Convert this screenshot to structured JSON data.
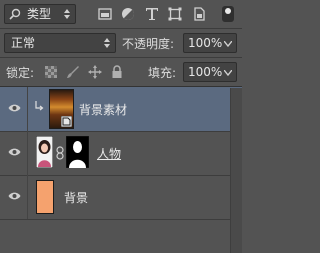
{
  "filter": {
    "kind_label": "类型"
  },
  "blend": {
    "mode": "正常",
    "opacity_label": "不透明度:",
    "opacity_value": "100%"
  },
  "lock": {
    "label": "锁定:",
    "fill_label": "填充:",
    "fill_value": "100%"
  },
  "layers": [
    {
      "name": "背景素材",
      "selected": true,
      "clipped": true
    },
    {
      "name": "人物"
    },
    {
      "name": "背景",
      "swatch": "#f5a26e"
    }
  ],
  "colors": {
    "panel": "#535353",
    "selected_row": "#5b6a80",
    "swatch": "#f5a26e"
  }
}
